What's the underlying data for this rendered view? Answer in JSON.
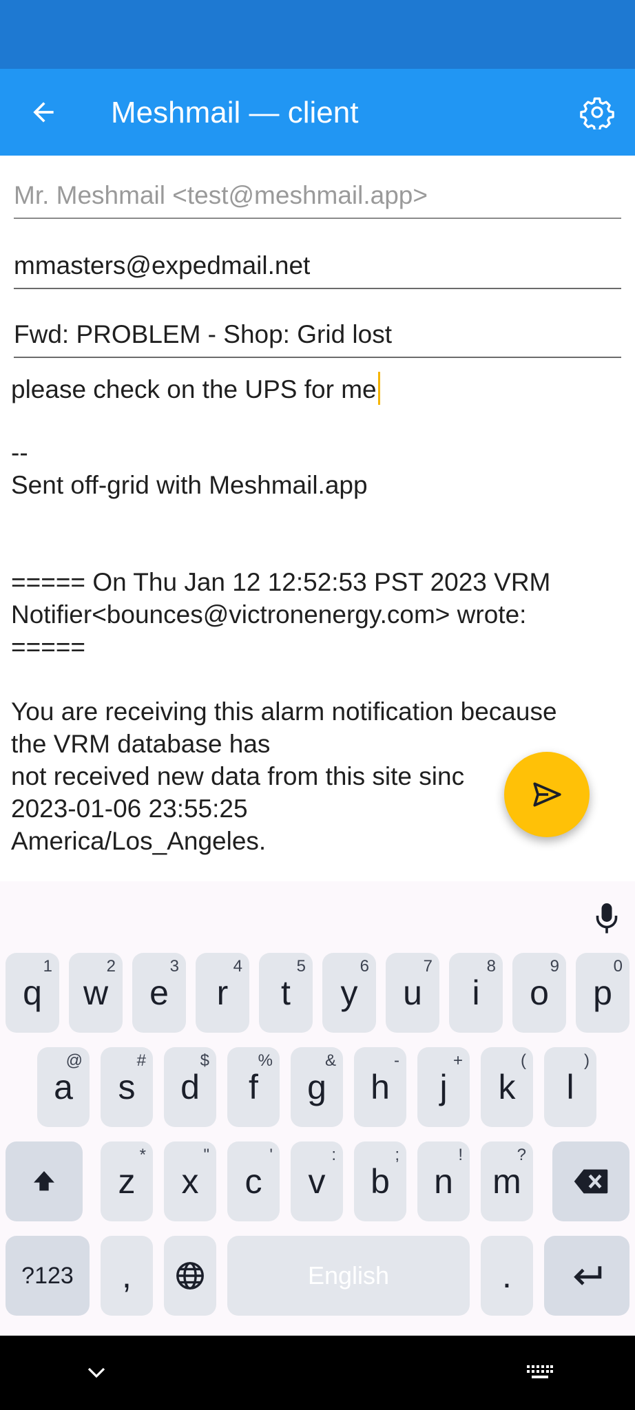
{
  "app": {
    "title": "Meshmail — client"
  },
  "icons": {
    "back": "arrow-left-icon",
    "settings": "gear-icon",
    "send": "send-icon",
    "mic": "microphone-icon",
    "shift": "shift-arrow-icon",
    "backspace": "backspace-icon",
    "globe": "globe-icon",
    "enter": "enter-arrow-icon",
    "nav_down": "chevron-down-icon",
    "nav_keyboard": "keyboard-icon"
  },
  "colors": {
    "status_bar": "#1E79D2",
    "app_bar": "#2196F3",
    "fab": "#FFC107",
    "caret": "#F5B400"
  },
  "compose": {
    "from_placeholder": "Mr. Meshmail <test@meshmail.app>",
    "to": "mmasters@expedmail.net",
    "subject": "Fwd: PROBLEM - Shop: Grid lost",
    "body_lines": [
      "please check on the UPS for me",
      "",
      "--",
      "Sent off-grid with Meshmail.app",
      "",
      "",
      "===== On Thu Jan 12 12:52:53 PST 2023 VRM",
      "Notifier<bounces@victronenergy.com> wrote:",
      "=====",
      "",
      "You are receiving this alarm notification because",
      "the VRM database has",
      "not received new data from this site sinc",
      "2023-01-06 23:55:25",
      "America/Los_Angeles."
    ]
  },
  "keyboard": {
    "row1": [
      {
        "k": "q",
        "s": "1"
      },
      {
        "k": "w",
        "s": "2"
      },
      {
        "k": "e",
        "s": "3"
      },
      {
        "k": "r",
        "s": "4"
      },
      {
        "k": "t",
        "s": "5"
      },
      {
        "k": "y",
        "s": "6"
      },
      {
        "k": "u",
        "s": "7"
      },
      {
        "k": "i",
        "s": "8"
      },
      {
        "k": "o",
        "s": "9"
      },
      {
        "k": "p",
        "s": "0"
      }
    ],
    "row2": [
      {
        "k": "a",
        "s": "@"
      },
      {
        "k": "s",
        "s": "#"
      },
      {
        "k": "d",
        "s": "$"
      },
      {
        "k": "f",
        "s": "%"
      },
      {
        "k": "g",
        "s": "&"
      },
      {
        "k": "h",
        "s": "-"
      },
      {
        "k": "j",
        "s": "+"
      },
      {
        "k": "k",
        "s": "("
      },
      {
        "k": "l",
        "s": ")"
      }
    ],
    "row3": [
      {
        "k": "z",
        "s": "*"
      },
      {
        "k": "x",
        "s": "\""
      },
      {
        "k": "c",
        "s": "'"
      },
      {
        "k": "v",
        "s": ":"
      },
      {
        "k": "b",
        "s": ";"
      },
      {
        "k": "n",
        "s": "!"
      },
      {
        "k": "m",
        "s": "?"
      }
    ],
    "symbols_label": "?123",
    "comma": ",",
    "space_label": "English",
    "period": "."
  }
}
